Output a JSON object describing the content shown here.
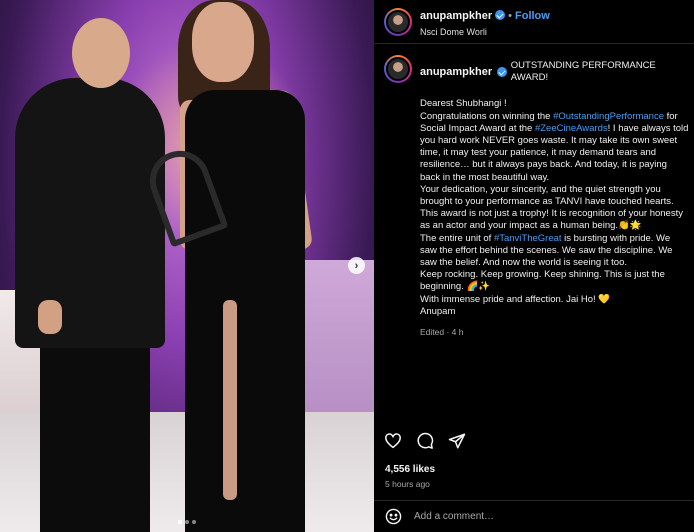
{
  "post": {
    "author": "anupampkher",
    "follow_label": "Follow",
    "separator": "•",
    "location": "Nsci Dome Worli",
    "caption_title": "OUTSTANDING PERFORMANCE AWARD!",
    "caption_lines": [
      "Dearest Shubhangi !",
      "Congratulations on winning the ",
      "#OutstandingPerformance",
      " for Social Impact Award at the ",
      "#ZeeCineAwards",
      "! I have always told you hard work NEVER goes waste. It may take its own sweet time, it may test your patience, it may demand tears and resilience… but it always pays back. And today, it is paying back in the most beautiful way.\nYour dedication, your sincerity, and the quiet strength you brought to your performance as TANVI have touched hearts. This award is not just a trophy! It is recognition of your honesty as an actor and your impact as a human being.👏🌟\nThe entire unit of ",
      "#TanviTheGreat",
      " is bursting with pride. We saw the effort behind the scenes. We saw the discipline. We saw the belief. And now the world is seeing it too.\nKeep rocking. Keep growing. Keep shining. This is just the beginning. 🌈✨\nWith immense pride and affection. Jai Ho! 💛\nAnupam"
    ],
    "edited": "Edited · 4 h",
    "likes": "4,556 likes",
    "timestamp": "5 hours ago"
  },
  "comment": {
    "placeholder": "Add a comment…"
  },
  "carousel": {
    "next_label": "›"
  },
  "colors": {
    "accent": "#4a9cf0",
    "verified": "#3897f0",
    "background": "#000000"
  },
  "icons": [
    "verified-icon",
    "heart-icon",
    "comment-icon",
    "share-icon",
    "emoji-icon",
    "carousel-next-icon"
  ]
}
